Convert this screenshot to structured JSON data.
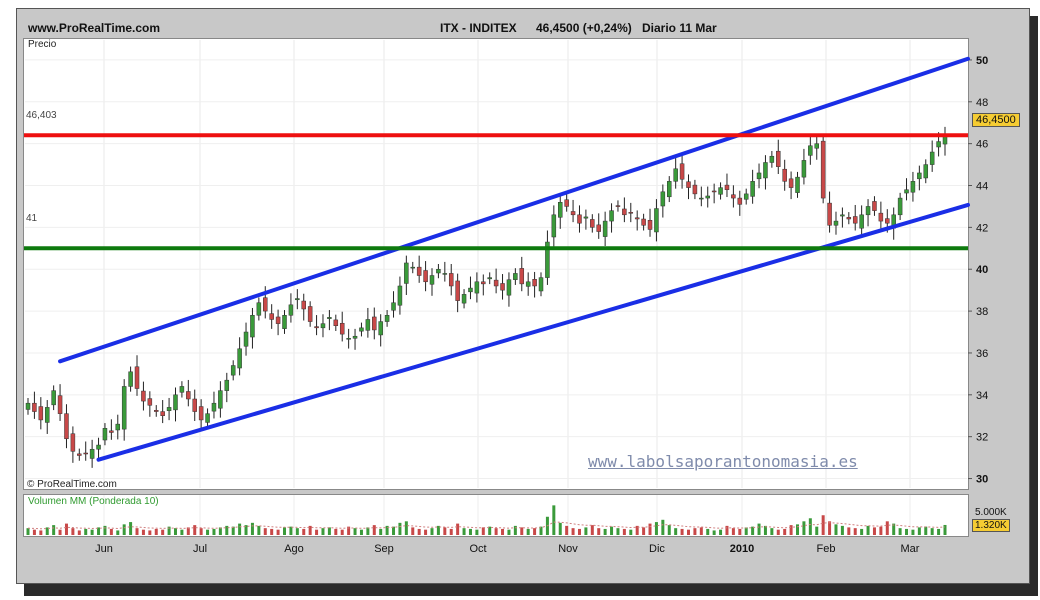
{
  "header": {
    "site": "www.ProRealTime.com",
    "ticker": "ITX - INDITEX",
    "price_change": "46,4500 (+0,24%)",
    "period_date": "Diario  11 Mar"
  },
  "price_panel": {
    "axis_label": "Precio",
    "copyright": "© ProRealTime.com",
    "watermark": "www.labolsaporantonomasia.es",
    "resistance_label": "46,403",
    "support_label": "41",
    "last_price_tag": "46,4500"
  },
  "volume_panel": {
    "label": "Volumen MM (Ponderada 10)",
    "scale_top": "5.000K",
    "current_value": "1.320K"
  },
  "colors": {
    "up_candle": "#3a9a3a",
    "down_candle": "#c84848",
    "channel_line": "#1a2ee6",
    "resistance_line": "#ee1010",
    "support_line": "#0e7a0e",
    "price_tag_bg": "#f5cc33"
  },
  "chart_data": {
    "type": "candlestick",
    "y_axis": {
      "min": 29.5,
      "max": 51,
      "ticks": [
        30,
        32,
        34,
        36,
        38,
        40,
        42,
        44,
        46,
        48,
        50
      ]
    },
    "x_axis": {
      "labels": [
        "Jun",
        "Jul",
        "Ago",
        "Sep",
        "Oct",
        "Nov",
        "Dic",
        "2010",
        "Feb",
        "Mar"
      ]
    },
    "closes": [
      33.6,
      33.2,
      32.8,
      33.4,
      34.2,
      33.1,
      31.9,
      31.3,
      31.1,
      31.2,
      31.4,
      31.6,
      32.4,
      32.2,
      32.6,
      34.4,
      35.1,
      34.3,
      33.7,
      33.5,
      33.2,
      33.0,
      33.4,
      34.0,
      34.4,
      33.8,
      33.2,
      32.8,
      33.1,
      33.6,
      34.2,
      34.7,
      35.4,
      36.2,
      37.0,
      37.8,
      38.4,
      38.0,
      37.6,
      37.4,
      37.8,
      38.3,
      38.6,
      38.1,
      37.5,
      37.2,
      37.4,
      37.7,
      37.3,
      36.9,
      36.7,
      36.8,
      37.2,
      37.6,
      37.1,
      37.5,
      37.8,
      38.4,
      39.2,
      40.3,
      40.1,
      39.7,
      39.4,
      39.7,
      40.0,
      39.8,
      39.2,
      38.5,
      38.8,
      39.1,
      39.4,
      39.3,
      39.6,
      39.2,
      39.0,
      39.5,
      39.8,
      39.3,
      39.4,
      39.2,
      39.6,
      41.3,
      42.6,
      43.2,
      43.0,
      42.6,
      42.2,
      42.5,
      42.0,
      41.8,
      42.3,
      42.8,
      43.0,
      42.6,
      42.7,
      42.4,
      42.1,
      41.9,
      42.9,
      43.7,
      44.2,
      44.8,
      44.3,
      43.9,
      43.6,
      43.4,
      43.5,
      43.7,
      43.9,
      43.8,
      43.4,
      43.1,
      43.6,
      44.2,
      44.6,
      45.1,
      45.4,
      44.9,
      44.2,
      43.9,
      44.4,
      45.2,
      45.9,
      46.0,
      43.4,
      42.1,
      42.3,
      42.6,
      42.4,
      42.2,
      42.6,
      43.0,
      42.8,
      42.3,
      42.2,
      42.6,
      43.4,
      43.8,
      44.2,
      44.6,
      45.0,
      45.6,
      46.1,
      46.45
    ],
    "volume": {
      "name": "Volumen MM (Ponderada 10)",
      "scale_max": 5000,
      "current": 1320,
      "values": [
        900,
        700,
        600,
        1000,
        1300,
        700,
        1500,
        900,
        600,
        800,
        700,
        1000,
        1200,
        800,
        600,
        1400,
        1700,
        900,
        700,
        600,
        800,
        700,
        1100,
        900,
        700,
        1000,
        1300,
        900,
        700,
        800,
        1000,
        1200,
        1100,
        1500,
        1300,
        1600,
        1200,
        900,
        800,
        700,
        1000,
        1100,
        900,
        800,
        1200,
        700,
        900,
        1000,
        800,
        700,
        1100,
        900,
        700,
        1000,
        1300,
        800,
        1200,
        1100,
        1600,
        1800,
        1000,
        800,
        700,
        900,
        1200,
        1000,
        800,
        1500,
        900,
        800,
        700,
        1000,
        1100,
        900,
        800,
        700,
        1200,
        1000,
        800,
        900,
        1100,
        2400,
        3900,
        1600,
        1200,
        900,
        800,
        1000,
        1300,
        900,
        800,
        1100,
        900,
        800,
        700,
        1200,
        1000,
        1500,
        1700,
        2000,
        1300,
        900,
        800,
        700,
        900,
        1000,
        800,
        600,
        700,
        1200,
        900,
        800,
        1000,
        1100,
        1500,
        1200,
        900,
        700,
        800,
        1300,
        1400,
        1800,
        2200,
        1100,
        2600,
        1800,
        1400,
        1200,
        1000,
        900,
        800,
        1200,
        1000,
        1100,
        1800,
        1500,
        900,
        800,
        700,
        1000,
        1100,
        900,
        800,
        1320
      ]
    },
    "lines": [
      {
        "name": "channel_upper",
        "from": {
          "index": 5,
          "value": 35.6
        },
        "to": {
          "index": 148,
          "value": 50.2
        }
      },
      {
        "name": "channel_lower",
        "from": {
          "index": 11,
          "value": 30.9
        },
        "to": {
          "index": 148,
          "value": 43.2
        }
      },
      {
        "name": "resistance",
        "value": 46.403
      },
      {
        "name": "support",
        "value": 41
      }
    ]
  }
}
